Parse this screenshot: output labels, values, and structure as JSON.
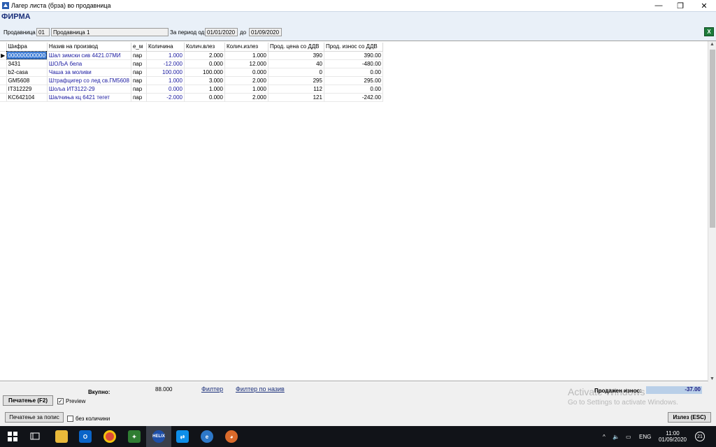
{
  "window": {
    "title": "Лагер листа (брза) во продавница",
    "minimize": "—",
    "maximize": "❐",
    "close": "✕"
  },
  "header": {
    "company": "ФИРМА",
    "store_label": "Продавница",
    "store_code": "01",
    "store_name": "Продавница 1",
    "period_label": "За период од",
    "date_from": "01/01/2020",
    "to_label": "до",
    "date_to": "01/09/2020",
    "excel_icon": "excel-export-icon"
  },
  "table": {
    "columns": [
      "Шифра",
      "Назив на производ",
      "е_м",
      "Количина",
      "Колич.влез",
      "Колич.излез",
      "Прод. цена со ДДВ",
      "Прод. износ со ДДВ"
    ],
    "rows": [
      [
        "000000000000",
        "Шал зимски сив 4421.07МИ",
        "пар",
        "1.000",
        "2.000",
        "1.000",
        "390",
        "390.00"
      ],
      [
        "3431",
        "ШОЉА бела",
        "пар",
        "-12.000",
        "0.000",
        "12.000",
        "40",
        "-480.00"
      ],
      [
        "b2-casa",
        "Чаша за моливи",
        "пар",
        "100.000",
        "100.000",
        "0.000",
        "0",
        "0.00"
      ],
      [
        "GM5608",
        "Штрафцигер со лед св.ГМ5608",
        "пар",
        "1.000",
        "3.000",
        "2.000",
        "295",
        "295.00"
      ],
      [
        "IT312229",
        "Шоља ИТ3122-29",
        "пар",
        "0.000",
        "1.000",
        "1.000",
        "112",
        "0.00"
      ],
      [
        "KC642104",
        "Шалчиња кц 6421 тегет",
        "пар",
        "-2.000",
        "0.000",
        "2.000",
        "121",
        "-242.00"
      ]
    ]
  },
  "footer": {
    "total_label": "Вкупно:",
    "total_value": "88.000",
    "filter_link": "Филтер",
    "filter_name_link": "Филтер по назив",
    "print_button": "Печатење (F2)",
    "preview_label": "Preview",
    "preview_checked": "✓",
    "print_list_button": "Печатење  за попис",
    "no_qty_label": "без количини",
    "sold_label": "Продажен износ:",
    "sold_value": "-37.00",
    "exit_button": "Излез (ESC)",
    "watermark_title": "Activate Windows",
    "watermark_sub": "Go to Settings to activate Windows."
  },
  "taskbar": {
    "apps": [
      "windows-start-icon",
      "task-view-icon",
      "file-explorer-icon",
      "outlook-icon",
      "chrome-icon",
      "app-icon",
      "helix-icon",
      "teamviewer-icon",
      "app-globe-icon",
      "paint-icon"
    ],
    "helix_label": "HELIX",
    "lang": "ENG",
    "time": "11:00",
    "date": "01/09/2020",
    "notifications": "21"
  }
}
